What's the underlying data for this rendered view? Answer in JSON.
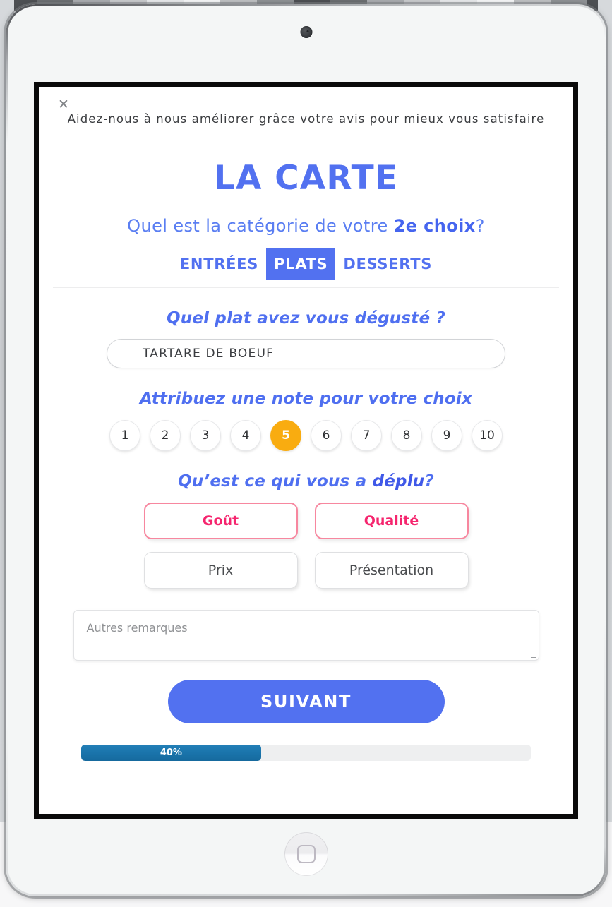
{
  "device": {
    "camera_icon": "camera-dot",
    "home_button_icon": "rounded-square-icon"
  },
  "modal": {
    "close_label": "✕",
    "intro": "Aidez-nous à nous améliorer grâce votre avis pour mieux vous satisfaire",
    "title": "LA CARTE",
    "subtitle_prefix": "Quel est la catégorie de votre ",
    "subtitle_strong": "2e choix",
    "subtitle_suffix": "?"
  },
  "tabs": [
    {
      "label": "ENTRÉES",
      "active": false
    },
    {
      "label": "PLATS",
      "active": true
    },
    {
      "label": "DESSERTS",
      "active": false
    }
  ],
  "dish": {
    "question": "Quel plat avez vous dégusté ?",
    "value": "TARTARE DE BOEUF",
    "placeholder": "TARTARE DE BOEUF"
  },
  "rating": {
    "question": "Attribuez une note pour votre choix",
    "options": [
      "1",
      "2",
      "3",
      "4",
      "5",
      "6",
      "7",
      "8",
      "9",
      "10"
    ],
    "selected": "5",
    "selected_color": "#f9ac10"
  },
  "reasons": {
    "question_prefix": "Qu’est ce qui vous a ",
    "question_strong": "déplu",
    "question_suffix": "?",
    "options": [
      {
        "label": "Goût",
        "selected": true
      },
      {
        "label": "Qualité",
        "selected": true
      },
      {
        "label": "Prix",
        "selected": false
      },
      {
        "label": "Présentation",
        "selected": false
      }
    ],
    "selected_color": "#f5256e"
  },
  "remarks": {
    "placeholder": "Autres remarques",
    "value": ""
  },
  "submit": {
    "label": "SUIVANT",
    "color": "#5271f0"
  },
  "progress": {
    "label": "40%",
    "percent": 40,
    "fill_color": "#1a74ab",
    "track_color": "#eeeff0"
  },
  "theme": {
    "accent_blue": "#5271f0",
    "accent_pink": "#f5256e",
    "accent_amber": "#f9ac10"
  }
}
